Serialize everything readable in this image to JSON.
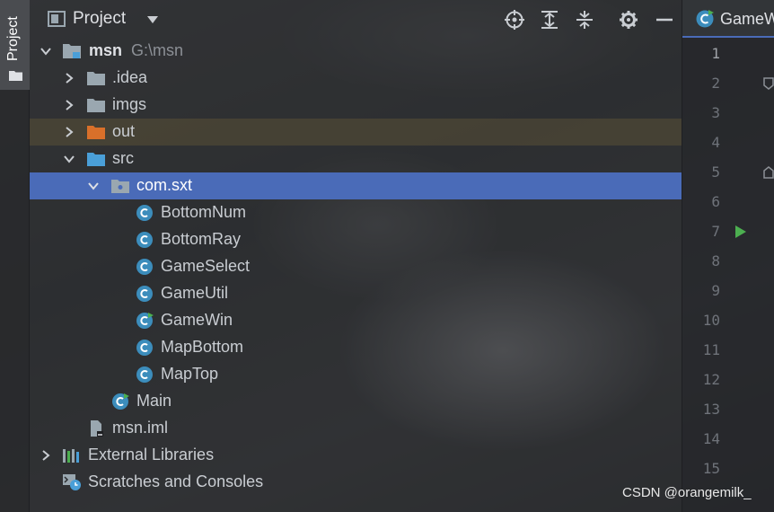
{
  "sidebar": {
    "tab_label": "Project"
  },
  "header": {
    "title": "Project"
  },
  "tree": [
    {
      "label": "msn",
      "path": "G:\\msn",
      "type": "module",
      "expanded": true
    },
    {
      "label": ".idea",
      "type": "folder",
      "expanded": false
    },
    {
      "label": "imgs",
      "type": "folder",
      "expanded": false
    },
    {
      "label": "out",
      "type": "folder-excluded",
      "expanded": false
    },
    {
      "label": "src",
      "type": "folder-source",
      "expanded": true
    },
    {
      "label": "com.sxt",
      "type": "package",
      "expanded": true,
      "selected": true
    },
    {
      "label": "BottomNum",
      "type": "class"
    },
    {
      "label": "BottomRay",
      "type": "class"
    },
    {
      "label": "GameSelect",
      "type": "class"
    },
    {
      "label": "GameUtil",
      "type": "class"
    },
    {
      "label": "GameWin",
      "type": "class-runnable"
    },
    {
      "label": "MapBottom",
      "type": "class"
    },
    {
      "label": "MapTop",
      "type": "class"
    },
    {
      "label": "Main",
      "type": "class-runnable"
    },
    {
      "label": "msn.iml",
      "type": "iml-file"
    },
    {
      "label": "External Libraries",
      "type": "libraries",
      "expanded": false
    },
    {
      "label": "Scratches and Consoles",
      "type": "scratches"
    }
  ],
  "editor": {
    "tab_label": "GameW",
    "line_numbers": [
      "1",
      "2",
      "3",
      "4",
      "5",
      "6",
      "7",
      "8",
      "9",
      "10",
      "11",
      "12",
      "13",
      "14",
      "15"
    ]
  },
  "watermark": "CSDN @orangemilk_",
  "colors": {
    "selection": "#4a6bb8",
    "class_icon": "#3c8dbc",
    "folder": "#9aa7b0",
    "source_folder": "#4a9fd8",
    "excluded_folder": "#d9702a",
    "run_arrow": "#4caf50"
  }
}
